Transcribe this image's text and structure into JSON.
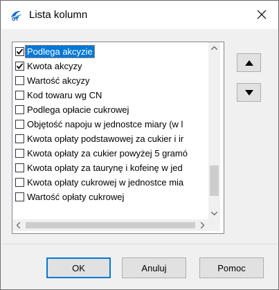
{
  "window": {
    "title": "Lista kolumn",
    "app_icon": "gt-app-icon",
    "close_icon": "close-icon"
  },
  "columns_list": {
    "items": [
      {
        "label": "Podlega akcyzie",
        "checked": true,
        "selected": true
      },
      {
        "label": "Kwota akcyzy",
        "checked": true,
        "selected": false
      },
      {
        "label": "Wartość akcyzy",
        "checked": false,
        "selected": false
      },
      {
        "label": "Kod towaru wg CN",
        "checked": false,
        "selected": false
      },
      {
        "label": "Podlega opłacie cukrowej",
        "checked": false,
        "selected": false
      },
      {
        "label": "Objętość napoju w jednostce miary (w l",
        "checked": false,
        "selected": false
      },
      {
        "label": "Kwota opłaty podstawowej za cukier i ir",
        "checked": false,
        "selected": false
      },
      {
        "label": "Kwota opłaty za cukier powyżej 5 gramó",
        "checked": false,
        "selected": false
      },
      {
        "label": "Kwota opłaty za taurynę i kofeinę w jed",
        "checked": false,
        "selected": false
      },
      {
        "label": "Kwota opłaty cukrowej w jednostce mia",
        "checked": false,
        "selected": false
      },
      {
        "label": "Wartość opłaty cukrowej",
        "checked": false,
        "selected": false
      }
    ]
  },
  "move_buttons": {
    "up_icon": "triangle-up-icon",
    "down_icon": "triangle-down-icon"
  },
  "footer": {
    "ok_label": "OK",
    "cancel_label": "Anuluj",
    "help_label": "Pomoc"
  },
  "colors": {
    "selection": "#0078d7",
    "button_face": "#e1e1e1",
    "dialog_bg": "#f0f0f0"
  }
}
